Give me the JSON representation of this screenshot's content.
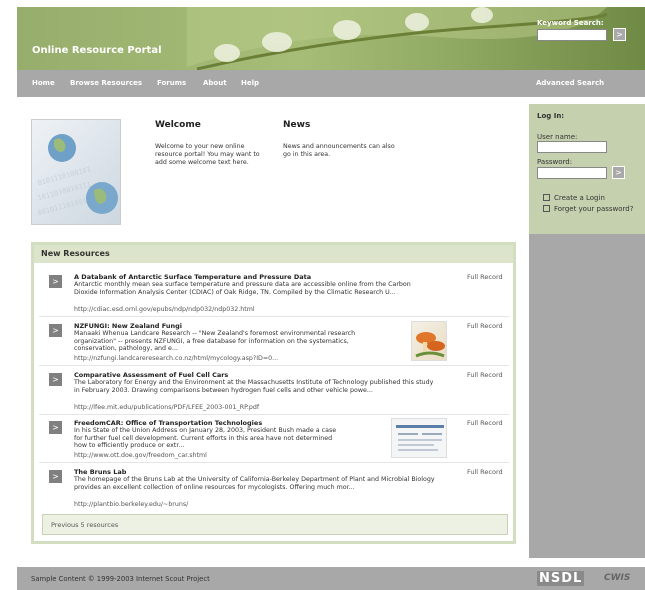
{
  "header": {
    "site_title": "Online Resource Portal",
    "keyword_label": "Keyword Search:",
    "keyword_value": "",
    "go_symbol": ">"
  },
  "nav": {
    "items": [
      "Home",
      "Browse Resources",
      "Forums",
      "About",
      "Help"
    ],
    "advanced": "Advanced Search"
  },
  "login": {
    "title": "Log In:",
    "username_label": "User name:",
    "password_label": "Password:",
    "go_symbol": ">",
    "links": [
      "Create a Login",
      "Forget your password?"
    ]
  },
  "welcome": {
    "heading": "Welcome",
    "text": "Welcome to your new online resource portal! You may want to add some welcome text here."
  },
  "news": {
    "heading": "News",
    "text": "News and announcements can also go in this area."
  },
  "new_resources": {
    "heading": "New Resources",
    "full_record_label": "Full Record",
    "arrow": ">",
    "items": [
      {
        "title": "A Databank of Antarctic Surface Temperature and Pressure Data",
        "desc": "Antarctic monthly mean sea surface temperature and pressure data are accessible online from the Carbon Dioxide Information Analysis Center (CDIAC) of Oak Ridge, TN. Compiled by the Climatic Research U...",
        "url": "http://cdiac.esd.ornl.gov/epubs/ndp/ndp032/ndp032.html"
      },
      {
        "title": "NZFUNGI: New Zealand Fungi",
        "desc": "Manaaki Whenua Landcare Research -- \"New Zealand's foremost environmental research organization\" -- presents NZFUNGI, a free database for information on the systematics, conservation, pathology, and e...",
        "url": "http://nzfungi.landcareresearch.co.nz/html/mycology.asp?ID=0..."
      },
      {
        "title": "Comparative Assessment of Fuel Cell Cars",
        "desc": "The Laboratory for Energy and the Environment at the Massachusetts Institute of Technology published this study in February 2003. Drawing comparisons between hydrogen fuel cells and other vehicle powe...",
        "url": "http://lfee.mit.edu/publications/PDF/LFEE_2003-001_RP.pdf"
      },
      {
        "title": "FreedomCAR: Office of Transportation Technologies",
        "desc": "In his State of the Union Address on January 28, 2003, President Bush made a case for further fuel cell development. Current efforts in this area have not determined how to efficiently produce or extr...",
        "url": "http://www.ott.doe.gov/freedom_car.shtml"
      },
      {
        "title": "The Bruns Lab",
        "desc": "The homepage of the Bruns Lab at the University of California-Berkeley Department of Plant and Microbial Biology provides an excellent collection of online resources for mycologists. Offering much mor...",
        "url": "http://plantbio.berkeley.edu/~bruns/"
      }
    ],
    "previous": "Previous 5 resources"
  },
  "footer": {
    "text": "Sample Content © 1999-2003 Internet Scout Project",
    "logo_nsdl": "NSDL",
    "logo_cwis": "CWIS"
  }
}
